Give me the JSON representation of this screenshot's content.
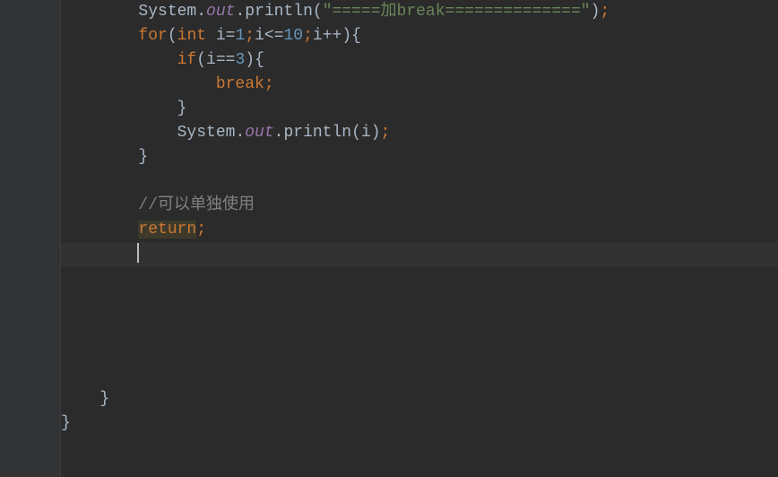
{
  "code": {
    "l1": {
      "system": "System",
      "dot1": ".",
      "out": "out",
      "dot2": ".",
      "println": "println",
      "lparen": "(",
      "str": "\"=====加break==============\"",
      "rparen": ")",
      "semi": ";"
    },
    "l2": {
      "for": "for",
      "lparen": "(",
      "int": "int",
      "var": " i",
      "eq": "=",
      "n1": "1",
      "semi1": ";",
      "cond": "i<=",
      "n10": "10",
      "semi2": ";",
      "inc": "i++",
      "rparen": ")",
      "lbrace": "{"
    },
    "l3": {
      "if": "if",
      "lparen": "(",
      "var": "i",
      "eq": "==",
      "n3": "3",
      "rparen": ")",
      "lbrace": "{"
    },
    "l4": {
      "break": "break",
      "semi": ";"
    },
    "l5": {
      "rbrace": "}"
    },
    "l6": {
      "system": "System",
      "dot1": ".",
      "out": "out",
      "dot2": ".",
      "println": "println",
      "lparen": "(",
      "var": "i",
      "rparen": ")",
      "semi": ";"
    },
    "l7": {
      "rbrace": "}"
    },
    "l9": {
      "comment": "//可以单独使用"
    },
    "l10": {
      "return": "return",
      "semi": ";"
    },
    "l17": {
      "rbrace": "}"
    },
    "l18": {
      "rbrace": "}"
    }
  }
}
